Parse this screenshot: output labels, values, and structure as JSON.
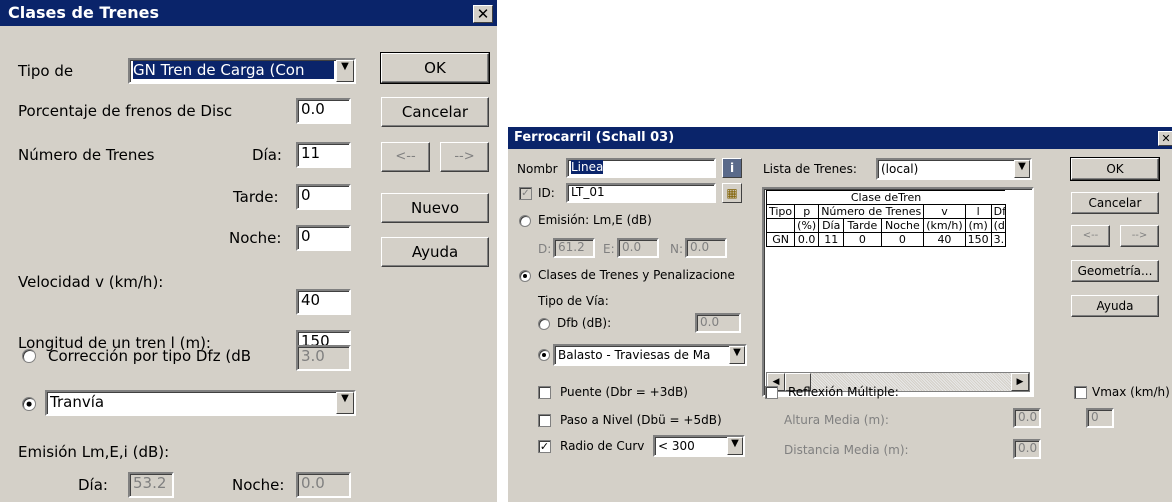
{
  "dialog1": {
    "title": "Clases de Trenes",
    "close_glyph": "✕",
    "tipo_label": "Tipo de",
    "tipo_value": "GN   Tren de Carga (Con",
    "porcentaje_label": "Porcentaje de frenos de Disc",
    "porcentaje_value": "0.0",
    "numero_label": "Número de Trenes",
    "dia_label": "Día:",
    "dia_value": "11",
    "tarde_label": "Tarde:",
    "tarde_value": "0",
    "noche_label": "Noche:",
    "noche_value": "0",
    "velocidad_label": "Velocidad v (km/h):",
    "velocidad_value": "40",
    "longitud_label": "Longitud de un tren l (m):",
    "longitud_value": "150",
    "correccion_label": "Corrección por tipo Dfz (dB",
    "correccion_value": "3.0",
    "tranvia_value": "Tranvía",
    "emision_label": "Emisión Lm,E,i (dB):",
    "emision_dia_label": "Día:",
    "emision_dia_value": "53.2",
    "emision_noche_label": "Noche:",
    "emision_noche_value": "0.0",
    "buttons": {
      "ok": "OK",
      "cancelar": "Cancelar",
      "prev": "<--",
      "next": "-->",
      "nuevo": "Nuevo",
      "ayuda": "Ayuda"
    }
  },
  "dialog2": {
    "title": "Ferrocarril (Schall 03)",
    "close_glyph": "✕",
    "nombre_label": "Nombr",
    "nombre_value": "Linea",
    "id_label": "ID:",
    "id_value": "LT_01",
    "emision_label": "Emisión: Lm,E (dB)",
    "d_label": "D:",
    "d_value": "61.2",
    "e_label": "E:",
    "e_value": "0.0",
    "n_label": "N:",
    "n_value": "0.0",
    "clases_label": "Clases de Trenes y Penalizacione",
    "tipo_via_label": "Tipo de Vía:",
    "dfb_label": "Dfb (dB):",
    "dfb_value": "0.0",
    "balasto_value": "Balasto - Traviesas de Ma",
    "puente_label": "Puente (Dbr = +3dB)",
    "paso_label": "Paso a Nivel (Dbü = +5dB)",
    "radio_label": "Radio de Curv",
    "radio_value": "< 300",
    "lista_label": "Lista de Trenes:",
    "lista_value": "(local)",
    "table": {
      "caption": "Clase deTren",
      "header1": [
        "Tipo",
        "p",
        "Número de Trenes",
        "v",
        "l",
        "Dfz"
      ],
      "header2": [
        "",
        "(%)",
        "Día",
        "Tarde",
        "Noche",
        "(km/h)",
        "(m)",
        "(dB"
      ],
      "row": [
        "GN",
        "0.0",
        "11",
        "0",
        "0",
        "40",
        "150",
        "3."
      ]
    },
    "reflexion_label": "Reflexión Múltiple:",
    "altura_label": "Altura Media (m):",
    "altura_value": "0.0",
    "distancia_label": "Distancia Media (m):",
    "distancia_value": "0.0",
    "vmax_label": "Vmax (km/h)",
    "vmax_value": "0",
    "buttons": {
      "ok": "OK",
      "cancelar": "Cancelar",
      "prev": "<--",
      "next": "-->",
      "geometria": "Geometría...",
      "ayuda": "Ayuda"
    },
    "icons": {
      "info": "i",
      "grid": "▦",
      "scroll_left": "◀",
      "scroll_right": "▶"
    }
  }
}
